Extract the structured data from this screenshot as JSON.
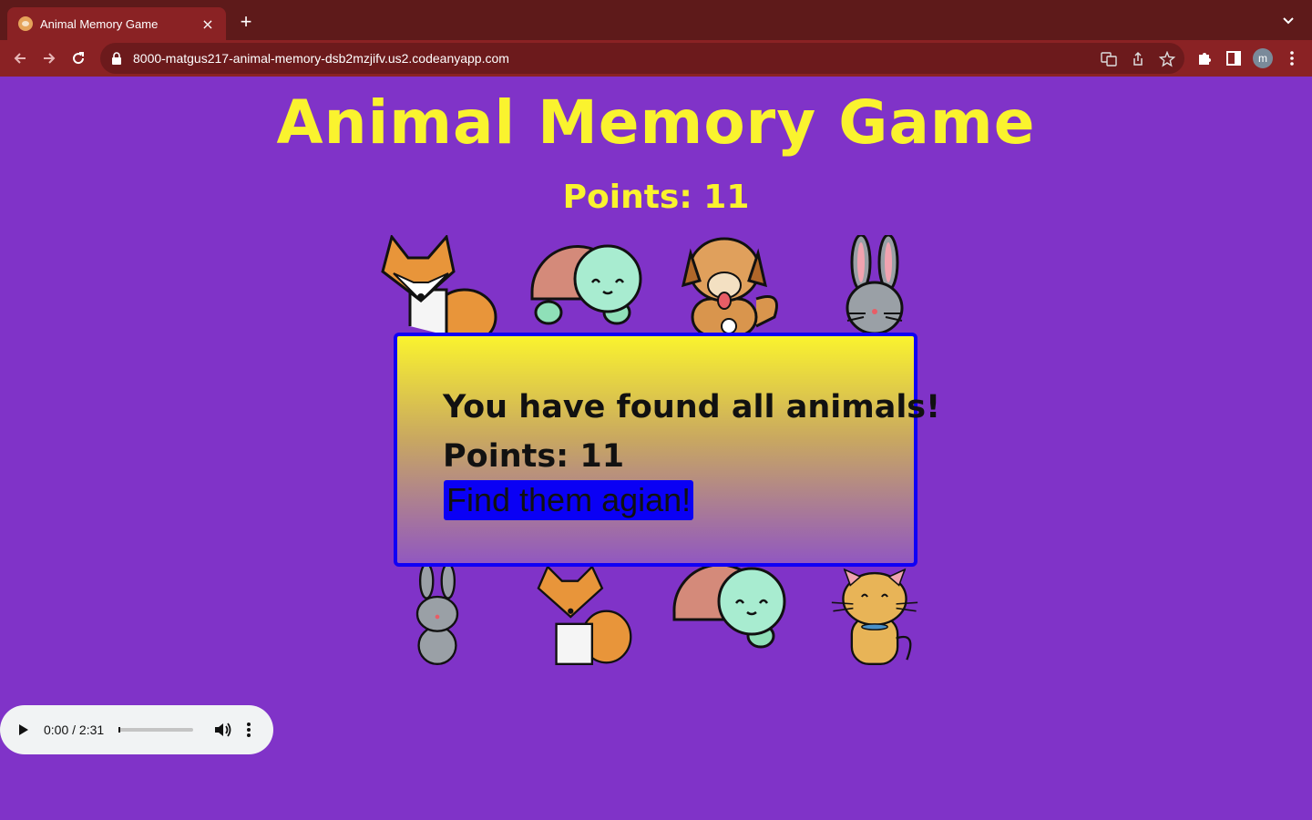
{
  "browser": {
    "tab_title": "Animal Memory Game",
    "tab_close": "×",
    "new_tab": "+",
    "url": "8000-matgus217-animal-memory-dsb2mzjifv.us2.codeanyapp.com",
    "profile_initial": "m"
  },
  "page": {
    "title": "Animal Memory Game",
    "points_label": "Points: 11"
  },
  "cards": [
    "fox",
    "turtle",
    "dog",
    "rabbit",
    "rabbit",
    "fox",
    "turtle",
    "cat"
  ],
  "modal": {
    "message": "You have found all animals!",
    "points": "Points: 11",
    "button_label": "Find them agian!"
  },
  "audio": {
    "time": "0:00 / 2:31"
  },
  "colors": {
    "background": "#8033c8",
    "title": "#faf32e",
    "modal_border": "#1000f5",
    "button": "#0a00f5"
  }
}
